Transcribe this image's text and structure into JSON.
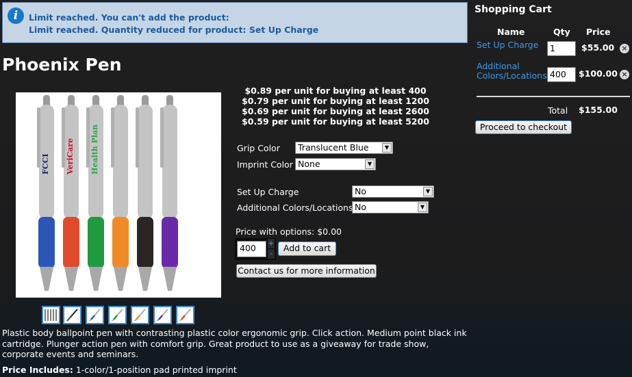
{
  "notice": {
    "line1": "Limit reached. You can't add the product:",
    "line2": "Limit reached. Quantity reduced for product: Set Up Charge",
    "icon": "info-icon"
  },
  "product": {
    "title": "Phoenix Pen",
    "pricing": [
      "$0.89 per unit for buying at least 400",
      "$0.79 per unit for buying at least 1200",
      "$0.69 per unit for buying at least 2600",
      "$0.59 per unit for buying at least 5200"
    ],
    "options": {
      "grip_color_label": "Grip Color",
      "grip_color_value": "Translucent Blue",
      "imprint_color_label": "Imprint Color",
      "imprint_color_value": "None",
      "setup_charge_label": "Set Up Charge",
      "setup_charge_value": "No",
      "additional_label": "Additional Colors/Locations",
      "additional_value": "No"
    },
    "price_with_options_label": "Price with options:",
    "price_with_options_value": "$0.00",
    "quantity": "400",
    "add_to_cart_label": "Add to cart",
    "contact_label": "Contact us for more information",
    "description": "Plastic body ballpoint pen with contrasting plastic color ergonomic grip. Click action. Medium point black ink cartridge. Plunger action pen with comfort grip. Great product to use as a giveaway for trade show, corporate events and seminars.",
    "includes_label": "Price Includes:",
    "includes_value": "1-color/1-position pad printed imprint",
    "pens": [
      {
        "grip": "#2b56b8",
        "imprint": "FCCI",
        "imprint_color": "#1a2a6a"
      },
      {
        "grip": "#e24a2c",
        "imprint": "VeriCare",
        "imprint_color": "#c8102e"
      },
      {
        "grip": "#1f9a3e",
        "imprint": "Health Plan",
        "imprint_color": "#2aa84a"
      },
      {
        "grip": "#f08a26",
        "imprint": "",
        "imprint_color": "#000"
      },
      {
        "grip": "#2a2522",
        "imprint": "",
        "imprint_color": "#000"
      },
      {
        "grip": "#6a2aa8",
        "imprint": "",
        "imprint_color": "#000"
      }
    ],
    "thumb_grips": [
      "#888888",
      "#1a1a1a",
      "#2b56b8",
      "#1f9a3e",
      "#f08a26",
      "#6a2aa8",
      "#e24a2c"
    ]
  },
  "cart": {
    "title": "Shopping Cart",
    "headers": {
      "name": "Name",
      "qty": "Qty",
      "price": "Price"
    },
    "items": [
      {
        "name": "Set Up Charge",
        "qty": "1",
        "price": "$55.00"
      },
      {
        "name": "Additional Colors/Locations",
        "qty": "400",
        "price": "$100.00"
      }
    ],
    "total_label": "Total",
    "total_value": "$155.00",
    "checkout_label": "Proceed to checkout"
  }
}
